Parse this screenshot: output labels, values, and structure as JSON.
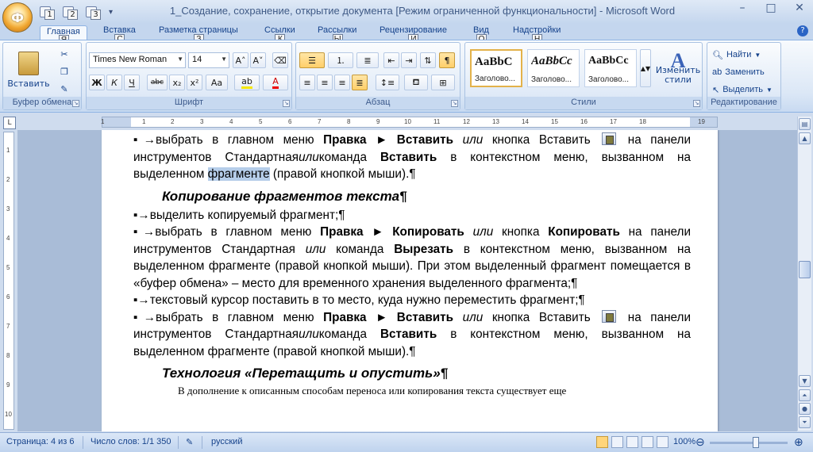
{
  "window": {
    "title": "1_Создание, сохранение, открытие документа [Режим ограниченной функциональности] - Microsoft Word",
    "office_button_key": "Ф",
    "qat_keytips": [
      "1",
      "2",
      "3"
    ],
    "controls": [
      "–",
      "□",
      "✕"
    ]
  },
  "tabs": [
    {
      "label": "Главная",
      "key": "Я",
      "active": true
    },
    {
      "label": "Вставка",
      "key": "С"
    },
    {
      "label": "Разметка страницы",
      "key": "З"
    },
    {
      "label": "Ссылки",
      "key": "К"
    },
    {
      "label": "Рассылки",
      "key": "Ы"
    },
    {
      "label": "Рецензирование",
      "key": "И"
    },
    {
      "label": "Вид",
      "key": "О"
    },
    {
      "label": "Надстройки",
      "key": "Н"
    }
  ],
  "ribbon": {
    "clipboard": {
      "label": "Буфер обмена",
      "paste_label": "Вставить"
    },
    "font": {
      "label": "Шрифт",
      "font_name": "Times New Roman",
      "font_size": "14"
    },
    "paragraph": {
      "label": "Абзац"
    },
    "styles": {
      "label": "Стили",
      "items": [
        {
          "sample": "AaBbC",
          "name": "Заголово..."
        },
        {
          "sample": "AaBbCc",
          "name": "Заголово..."
        },
        {
          "sample": "AaBbCc",
          "name": "Заголово..."
        }
      ],
      "change_styles": "Изменить стили"
    },
    "editing": {
      "label": "Редактирование",
      "find": "Найти",
      "replace": "Заменить",
      "select": "Выделить"
    }
  },
  "ruler": {
    "h_ticks": [
      "1",
      "1",
      "2",
      "3",
      "4",
      "5",
      "6",
      "7",
      "8",
      "9",
      "10",
      "11",
      "12",
      "13",
      "14",
      "15",
      "16",
      "17",
      "18",
      "19"
    ],
    "v_ticks": [
      "1",
      "2",
      "3",
      "4",
      "5",
      "6",
      "7",
      "8",
      "9",
      "10"
    ]
  },
  "document": {
    "p1_a": "▪→выбрать в главном меню ",
    "p1_b": "Правка",
    "p1_c": " ► ",
    "p1_d": "Вставить",
    "p1_e": " ",
    "p1_f": "или",
    "p1_g": " кнопка Вставить ",
    "p1_h": " на панели инструментов Стандартная",
    "p1_i": "или",
    "p1_j": "команда ",
    "p1_k": "Вставить",
    "p1_l": " в контекстном меню, вызванном на выделенном ",
    "p1_m": "фрагменте",
    "p1_n": " (правой кнопкой мыши).¶",
    "h1": "Копирование фрагментов текста¶",
    "p2": "▪→выделить копируемый фрагмент;¶",
    "p3_a": "▪→выбрать в главном меню ",
    "p3_b": "Правка",
    "p3_c": " ► ",
    "p3_d": "Копировать",
    "p3_e": " ",
    "p3_f": "или",
    "p3_g": " кнопка ",
    "p3_h": "Копировать",
    "p3_i": "  на панели инструментов Стандартная ",
    "p3_j": "или",
    "p3_k": " команда ",
    "p3_l": "Вырезать",
    "p3_m": " в контекстном меню, вызванном на выделенном фрагменте (правой кнопкой мыши). При этом выделенный фрагмент помещается в «буфер обмена» – место для временного хранения выделенного фрагмента;¶",
    "p4": "▪→текстовый курсор поставить в то место, куда нужно переместить фрагмент;¶",
    "p5_a": "▪→выбрать в главном меню ",
    "p5_b": "Правка",
    "p5_c": " ► ",
    "p5_d": "Вставить",
    "p5_e": " ",
    "p5_f": "или",
    "p5_g": " кнопка Вставить ",
    "p5_h": " на панели инструментов Стандартная",
    "p5_i": "или",
    "p5_j": "команда ",
    "p5_k": "Вставить",
    "p5_l": " в контекстном меню, вызванном на выделенном фрагменте (правой кнопкой мыши).¶",
    "h2": "Технология «Перетащить и опустить»¶",
    "p6": "В дополнение к описанным способам переноса или копирования текста существует еще"
  },
  "statusbar": {
    "page": "Страница: 4 из 6",
    "words": "Число слов: 1/1 350",
    "language": "русский",
    "zoom": "100%",
    "zoom_level": 1.0
  }
}
